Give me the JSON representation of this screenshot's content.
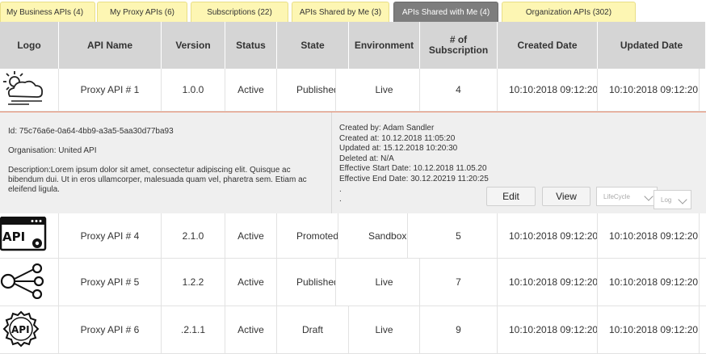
{
  "tabs": [
    {
      "label": "My Business APIs (4)"
    },
    {
      "label": "My Proxy APIs (6)"
    },
    {
      "label": "Subscriptions (22)"
    },
    {
      "label": "APIs Shared by Me (3)"
    },
    {
      "label": "APIs Shared with Me (4)"
    },
    {
      "label": "Organization APIs (302)"
    }
  ],
  "active_tab": "APIs Shared with Me (4)",
  "columns": [
    "Logo",
    "API Name",
    "Version",
    "Status",
    "State",
    "Environment",
    "# of Subscription",
    "Created Date",
    "Updated Date"
  ],
  "rows": [
    {
      "icon": "cloud-sun-icon",
      "name": "Proxy API # 1",
      "version": "1.0.0",
      "status": "Active",
      "state": "Published",
      "environment": "Live",
      "subs": "4",
      "created": "10:10:2018 09:12:20",
      "updated": "10:10:2018 09:12:20"
    },
    {
      "icon": "api-window-icon",
      "name": "Proxy API # 4",
      "version": "2.1.0",
      "status": "Active",
      "state": "Promoted",
      "environment": "Sandbox",
      "subs": "5",
      "created": "10:10:2018 09:12:20",
      "updated": "10:10:2018 09:12:20"
    },
    {
      "icon": "share-network-icon",
      "name": "Proxy API # 5",
      "version": "1.2.2",
      "status": "Active",
      "state": "Published",
      "environment": "Live",
      "subs": "7",
      "created": "10:10:2018 09:12:20",
      "updated": "10:10:2018 09:12:20"
    },
    {
      "icon": "api-gear-icon",
      "name": "Proxy API # 6",
      "version": ".2.1.1",
      "status": "Active",
      "state": "Draft",
      "environment": "Live",
      "subs": "9",
      "created": "10:10:2018 09:12:20",
      "updated": "10:10:2018 09:12:20"
    }
  ],
  "detail": {
    "id": "Id: 75c76a6e-0a64-4bb9-a3a5-5aa30d77ba93",
    "organisation": "Organisation: United API",
    "description": "Description:Lorem ipsum dolor sit amet, consectetur adipiscing elit. Quisque ac bibendum dui. Ut in eros ullamcorper, malesuada quam vel, pharetra sem. Etiam ac eleifend ligula.",
    "created_by": "Created by: Adam Sandler",
    "created_at": "Created at: 10.12.2018 11:05:20",
    "updated_at": "Updated at: 15.12.2018 10:20:30",
    "deleted_at": "Deleted at: N/A",
    "effective_start": "Effective Start Date: 10.12.2018 11.05.20",
    "effective_end": "Effective End Date:  30.12.20219 11:20:25",
    "dot1": ".",
    "dot2": ".",
    "edit_label": "Edit",
    "view_label": "View",
    "lifecycle_placeholder": "LifeCycle",
    "log_placeholder": "Log"
  },
  "colors": {
    "tab_bg": "#fdf6b3",
    "tab_active": "#7d7d7d",
    "header_bg": "#d5d5d5",
    "detail_border": "#e88a6a"
  }
}
